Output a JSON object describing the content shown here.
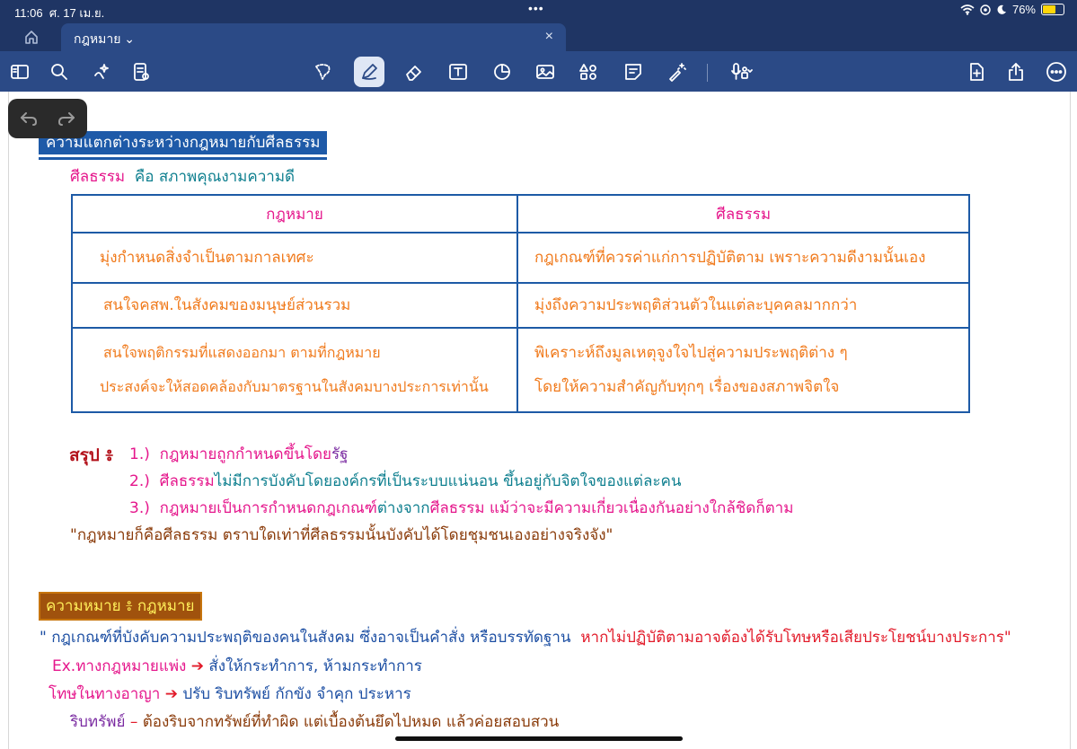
{
  "status_bar": {
    "time": "11:06",
    "date": "ศ. 17 เม.ย.",
    "battery": "76%",
    "battery_level": 0.76
  },
  "tab": {
    "title": "กฎหมาย",
    "close": "×"
  },
  "toolbar": {
    "left_icons": [
      "sidebar-icon",
      "search-icon",
      "ai-sparkle-icon",
      "document-icon"
    ],
    "center_icons": [
      "lasso-icon",
      "pen-icon",
      "eraser-icon",
      "text-box-icon",
      "shapes-icon",
      "image-icon",
      "elements-icon",
      "sticky-note-icon",
      "laser-icon",
      "microphone-icon"
    ],
    "right_icons": [
      "add-page-icon",
      "share-icon",
      "more-icon"
    ],
    "active_tool": "pen"
  },
  "note": {
    "heading1": "ความแตกต่างระหว่างกฎหมายกับศีลธรรม",
    "definition": {
      "term": "ศีลธรรม",
      "text": "คือ สภาพคุณงามความดี"
    },
    "table": {
      "headers": [
        "กฎหมาย",
        "ศีลธรรม"
      ],
      "rows": [
        [
          [
            "มุ่งกำหนดสิ่งจำเป็นตามกาลเทศะ"
          ],
          [
            "กฎเกณฑ์ที่ควรค่าแก่การปฏิบัติตาม  เพราะความดีงามนั้นเอง"
          ]
        ],
        [
          [
            "สนใจคสพ.ในสังคมของมนุษย์ส่วนรวม"
          ],
          [
            "มุ่งถึงความประพฤติส่วนตัวในแต่ละบุคคลมากกว่า"
          ]
        ],
        [
          [
            "สนใจพฤติกรรมที่แสดงออกมา  ตามที่กฎหมาย",
            "ประสงค์จะให้สอดคล้องกับมาตรฐานในสังคมบางประการเท่านั้น"
          ],
          [
            "พิเคราะห์ถึงมูลเหตุจูงใจไปสู่ความประพฤติต่าง ๆ",
            "โดยให้ความสำคัญกับทุกๆ เรื่องของสภาพจิตใจ"
          ]
        ]
      ]
    },
    "summary": {
      "label": "สรุป ៖",
      "items": [
        {
          "num": "1.)",
          "parts": [
            "กฎหมายถูกกำหนดขึ้นโดย",
            "รัฐ"
          ]
        },
        {
          "num": "2.)",
          "parts": [
            "ศีลธรรม",
            "ไม่มีการบังคับโดยองค์กรที่เป็นระบบแน่นอน  ขึ้นอยู่กับจิตใจของแต่ละคน"
          ]
        },
        {
          "num": "3.)",
          "parts": [
            "กฎหมายเป็นการกำหนดกฎเกณฑ์",
            "ต่างจาก",
            "ศีลธรรม",
            "  แม้ว่าจะมีความเกี่ยวเนื่องกันอย่างใกล้ชิดก็ตาม"
          ]
        }
      ],
      "quote": "\"กฎหมายก็คือศีลธรรม  ตราบใดเท่าที่ศีลธรรมนั้นบังคับได้โดยชุมชนเองอย่างจริงจัง\""
    },
    "heading2": "ความหมาย ៖ กฎหมาย",
    "meaning": {
      "part1": "\" กฎเกณฑ์ที่บังคับความประพฤติของคนในสังคม  ซึ่งอาจเป็นคำสั่ง  หรือบรรทัดฐาน",
      "part2": "หากไม่ปฏิบัติตามอาจต้องได้รับโทษหรือเสียประโยชน์บางประการ\""
    },
    "ex_civil": {
      "label": "Ex.ทางกฎหมายแพ่ง",
      "arrow": "➔",
      "text": "สั่งให้กระทำการ, ห้ามกระทำการ"
    },
    "ex_criminal": {
      "label": "โทษในทางอาญา",
      "arrow": "➔",
      "text": "ปรับ  ริบทรัพย์  กักขัง  จำคุก  ประหาร"
    },
    "confiscation": {
      "label": "ริบทรัพย์",
      "dash": "–",
      "text": "ต้องริบจากทรัพย์ที่ทำผิด  แต่เบื้องต้นยึดไปหมด  แล้วค่อยสอบสวน"
    }
  },
  "colors": {
    "statusbar_bg": "#1f3564",
    "toolbar_bg": "#2b4a86",
    "heading1_bg": "#1e5aa8",
    "heading2_bg": "#a0520d",
    "table_border": "#1d5aa6",
    "pink": "#e5178c",
    "orange": "#f07a1c",
    "teal": "#0e7f8f"
  }
}
